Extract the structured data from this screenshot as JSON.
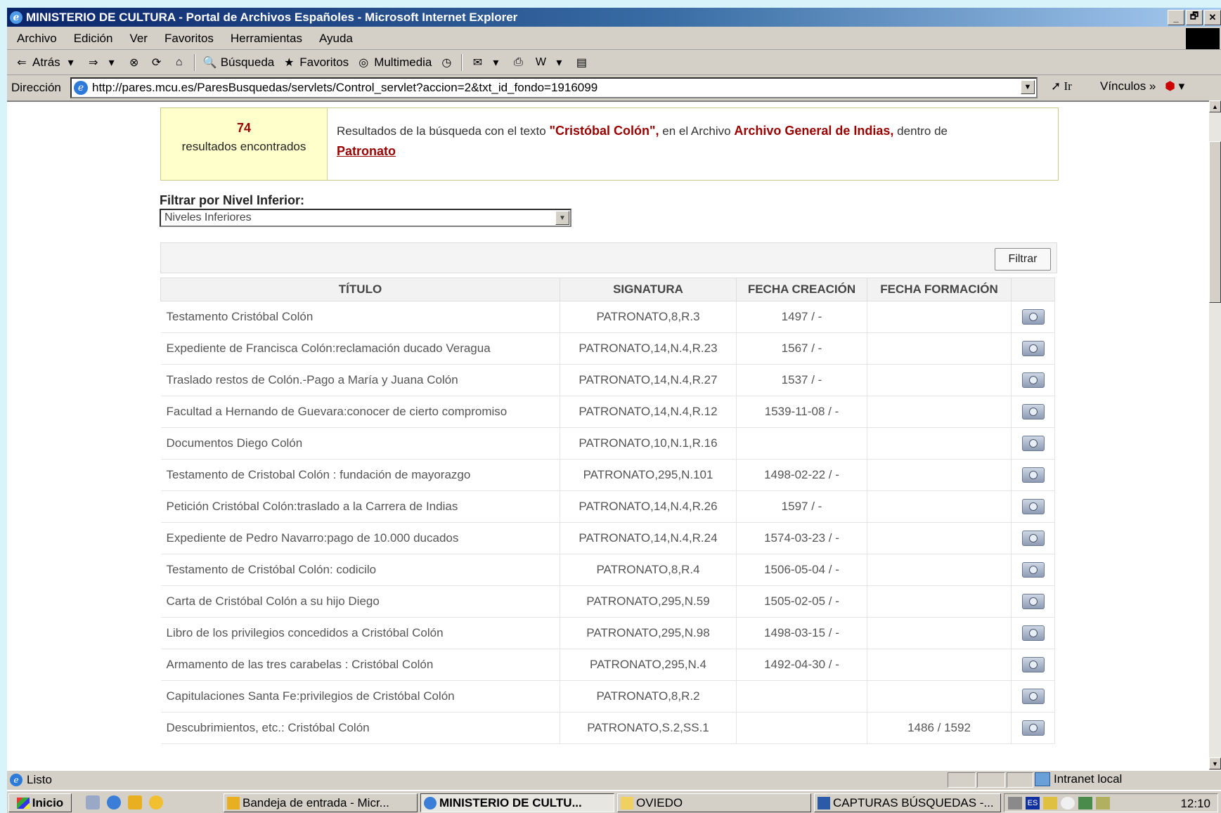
{
  "window": {
    "title": "MINISTERIO DE CULTURA - Portal de Archivos Españoles - Microsoft Internet Explorer",
    "buttons": [
      "_",
      "🗗",
      "✕"
    ]
  },
  "menu": [
    "Archivo",
    "Edición",
    "Ver",
    "Favoritos",
    "Herramientas",
    "Ayuda"
  ],
  "toolbar": {
    "back": "Atrás",
    "search": "Búsqueda",
    "favorites": "Favoritos",
    "media": "Multimedia"
  },
  "address": {
    "label": "Dirección",
    "url": "http://pares.mcu.es/ParesBusquedas/servlets/Control_servlet?accion=2&txt_id_fondo=1916099",
    "go": "Ir",
    "links": "Vínculos"
  },
  "summary": {
    "count": "74",
    "count_label": "resultados encontrados",
    "text_before": "Resultados de la búsqueda con el texto",
    "query": "\"Cristóbal Colón\",",
    "text_archive": "en el Archivo",
    "archive": "Archivo General de Indias,",
    "text_within": "dentro de",
    "fondo": "Patronato"
  },
  "filter": {
    "label": "Filtrar por Nivel Inferior:",
    "selected": "Niveles Inferiores",
    "button": "Filtrar"
  },
  "table": {
    "headers": [
      "TÍTULO",
      "SIGNATURA",
      "FECHA CREACIÓN",
      "FECHA FORMACIÓN"
    ],
    "rows": [
      {
        "titulo": "Testamento Cristóbal Colón",
        "signatura": "PATRONATO,8,R.3",
        "creacion": "1497 / -",
        "formacion": ""
      },
      {
        "titulo": "Expediente de Francisca Colón:reclamación ducado Veragua",
        "signatura": "PATRONATO,14,N.4,R.23",
        "creacion": "1567 / -",
        "formacion": ""
      },
      {
        "titulo": "Traslado restos de Colón.-Pago a María y Juana Colón",
        "signatura": "PATRONATO,14,N.4,R.27",
        "creacion": "1537 / -",
        "formacion": ""
      },
      {
        "titulo": "Facultad a Hernando de Guevara:conocer de cierto compromiso",
        "signatura": "PATRONATO,14,N.4,R.12",
        "creacion": "1539-11-08 / -",
        "formacion": ""
      },
      {
        "titulo": "Documentos Diego Colón",
        "signatura": "PATRONATO,10,N.1,R.16",
        "creacion": "",
        "formacion": ""
      },
      {
        "titulo": "Testamento de Cristobal Colón : fundación de mayorazgo",
        "signatura": "PATRONATO,295,N.101",
        "creacion": "1498-02-22 / -",
        "formacion": ""
      },
      {
        "titulo": "Petición Cristóbal Colón:traslado a la Carrera de Indias",
        "signatura": "PATRONATO,14,N.4,R.26",
        "creacion": "1597 / -",
        "formacion": ""
      },
      {
        "titulo": "Expediente de Pedro Navarro:pago de 10.000 ducados",
        "signatura": "PATRONATO,14,N.4,R.24",
        "creacion": "1574-03-23 / -",
        "formacion": ""
      },
      {
        "titulo": "Testamento de Cristóbal Colón: codicilo",
        "signatura": "PATRONATO,8,R.4",
        "creacion": "1506-05-04 / -",
        "formacion": ""
      },
      {
        "titulo": "Carta de Cristóbal Colón a su hijo Diego",
        "signatura": "PATRONATO,295,N.59",
        "creacion": "1505-02-05 / -",
        "formacion": ""
      },
      {
        "titulo": "Libro de los privilegios concedidos a Cristóbal Colón",
        "signatura": "PATRONATO,295,N.98",
        "creacion": "1498-03-15 / -",
        "formacion": ""
      },
      {
        "titulo": "Armamento de las tres carabelas : Cristóbal Colón",
        "signatura": "PATRONATO,295,N.4",
        "creacion": "1492-04-30 / -",
        "formacion": ""
      },
      {
        "titulo": "Capitulaciones Santa Fe:privilegios de Cristóbal Colón",
        "signatura": "PATRONATO,8,R.2",
        "creacion": "",
        "formacion": ""
      },
      {
        "titulo": "Descubrimientos, etc.: Cristóbal Colón",
        "signatura": "PATRONATO,S.2,SS.1",
        "creacion": "",
        "formacion": "1486 / 1592"
      }
    ]
  },
  "status": {
    "text": "Listo",
    "zone": "Intranet local"
  },
  "taskbar": {
    "start": "Inicio",
    "tasks": [
      "Bandeja de entrada - Micr...",
      "MINISTERIO DE CULTU...",
      "OVIEDO",
      "CAPTURAS BÚSQUEDAS -..."
    ],
    "lang": "ES",
    "clock": "12:10"
  }
}
